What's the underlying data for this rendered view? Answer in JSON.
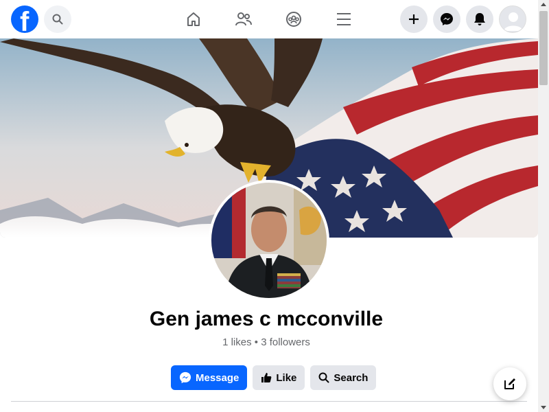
{
  "topbar": {
    "logo": "facebook-logo",
    "logo_letter": "f",
    "icons": [
      "search-icon",
      "home-icon",
      "friends-icon",
      "groups-icon",
      "menu-icon",
      "create-icon",
      "messenger-icon",
      "notifications-icon",
      "profile-icon"
    ]
  },
  "profile": {
    "name": "Gen james c mcconville",
    "stats": "1 likes • 3 followers"
  },
  "actions": {
    "message_label": "Message",
    "like_label": "Like",
    "search_label": "Search"
  },
  "colors": {
    "brand": "#0866ff",
    "button_gray": "#e4e6eb",
    "text_primary": "#050505",
    "text_secondary": "#65676b"
  }
}
